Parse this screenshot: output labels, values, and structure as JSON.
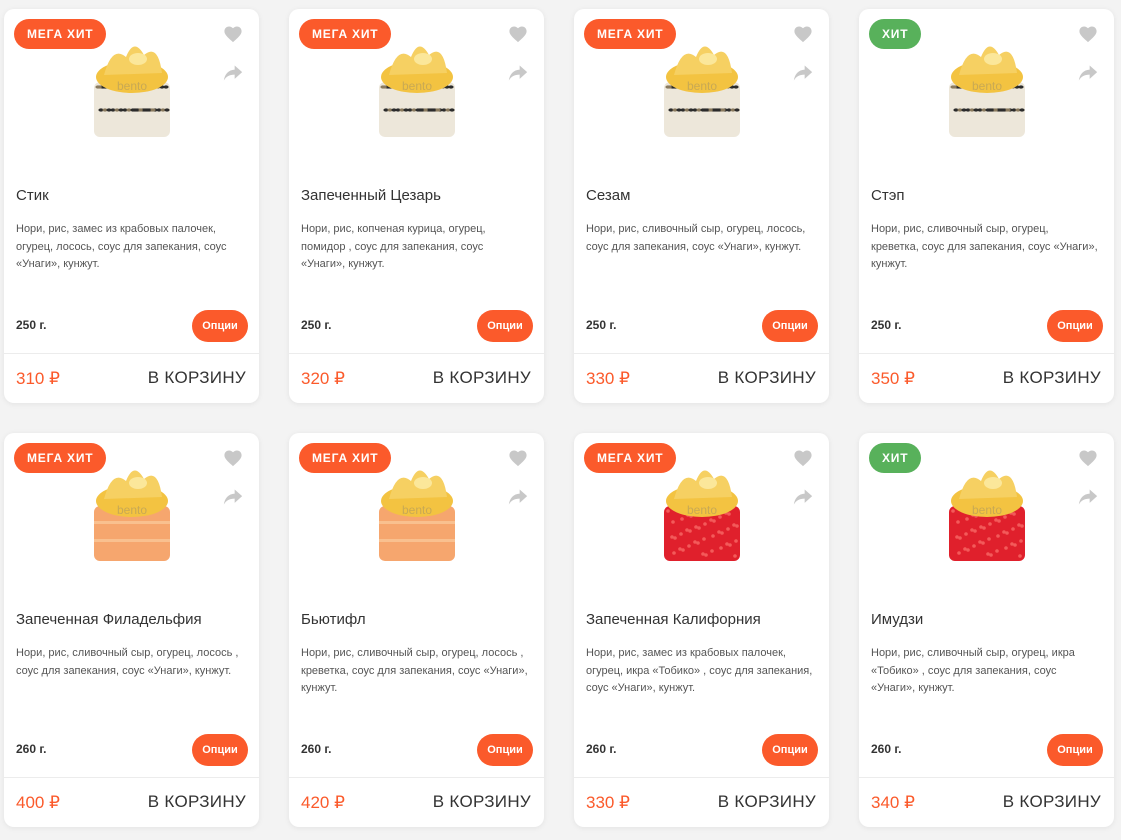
{
  "colors": {
    "accent": "#fb5a2b",
    "hit_badge": "#58b15b",
    "icon_grey": "#c8c8c8"
  },
  "ui": {
    "options_label": "Опции",
    "cart_label": "В КОРЗИНУ"
  },
  "products": [
    {
      "badge": "МЕГА ХИТ",
      "badge_type": "mega",
      "name": "Стик",
      "description": "Нори, рис, замес из крабовых палочек, огурец, лосось, соус для запекания, соус «Унаги», кунжут.",
      "weight": "250 г.",
      "price": "310 ₽",
      "image": "sesame-roll"
    },
    {
      "badge": "МЕГА ХИТ",
      "badge_type": "mega",
      "name": "Запеченный Цезарь",
      "description": "Нори, рис, копченая курица, огурец, помидор , соус для запекания, соус «Унаги», кунжут.",
      "weight": "250 г.",
      "price": "320 ₽",
      "image": "sesame-roll"
    },
    {
      "badge": "МЕГА ХИТ",
      "badge_type": "mega",
      "name": "Сезам",
      "description": "Нори, рис, сливочный сыр, огурец, лосось, соус для запекания, соус «Унаги», кунжут.",
      "weight": "250 г.",
      "price": "330 ₽",
      "image": "sesame-roll"
    },
    {
      "badge": "ХИТ",
      "badge_type": "hit",
      "name": "Стэп",
      "description": "Нори, рис, сливочный сыр, огурец, креветка, соус для запекания, соус «Унаги», кунжут.",
      "weight": "250 г.",
      "price": "350 ₽",
      "image": "sesame-roll"
    },
    {
      "badge": "МЕГА ХИТ",
      "badge_type": "mega",
      "name": "Запеченная Филадельфия",
      "description": "Нори, рис, сливочный сыр, огурец, лосось , соус для запекания, соус «Унаги», кунжут.",
      "weight": "260 г.",
      "price": "400 ₽",
      "image": "salmon-roll"
    },
    {
      "badge": "МЕГА ХИТ",
      "badge_type": "mega",
      "name": "Бьютифл",
      "description": "Нори, рис, сливочный сыр, огурец, лосось , креветка, соус для запекания, соус «Унаги», кунжут.",
      "weight": "260 г.",
      "price": "420 ₽",
      "image": "salmon-roll"
    },
    {
      "badge": "МЕГА ХИТ",
      "badge_type": "mega",
      "name": "Запеченная Калифорния",
      "description": "Нори, рис, замес из крабовых палочек, огурец, икра «Тобико» , соус для запекания, соус «Унаги», кунжут.",
      "weight": "260 г.",
      "price": "330 ₽",
      "image": "tobiko-roll"
    },
    {
      "badge": "ХИТ",
      "badge_type": "hit",
      "name": "Имудзи",
      "description": "Нори, рис, сливочный сыр, огурец, икра «Тобико» , соус для запекания, соус «Унаги», кунжут.",
      "weight": "260 г.",
      "price": "340 ₽",
      "image": "tobiko-roll"
    }
  ]
}
